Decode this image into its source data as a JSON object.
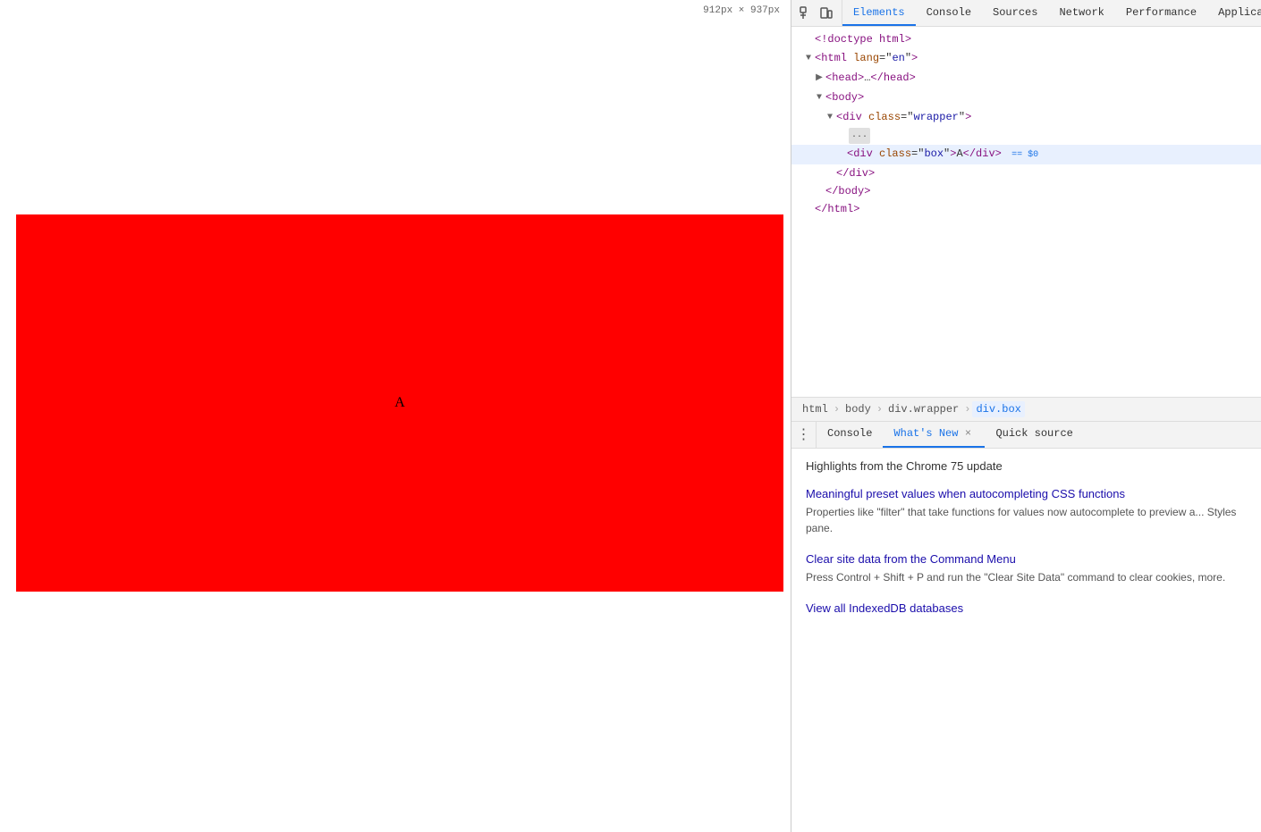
{
  "viewport": {
    "size_label": "912px × 937px",
    "red_box_text": "A"
  },
  "devtools": {
    "tabs": [
      {
        "id": "elements",
        "label": "Elements",
        "active": true
      },
      {
        "id": "console",
        "label": "Console",
        "active": false
      },
      {
        "id": "sources",
        "label": "Sources",
        "active": false
      },
      {
        "id": "network",
        "label": "Network",
        "active": false
      },
      {
        "id": "performance",
        "label": "Performance",
        "active": false
      },
      {
        "id": "application",
        "label": "Applicati...",
        "active": false
      }
    ],
    "html_tree": {
      "lines": [
        {
          "id": "doctype",
          "indent": 0,
          "toggle": "none",
          "content": "<!doctype html>",
          "type": "doctype"
        },
        {
          "id": "html-open",
          "indent": 0,
          "toggle": "expanded",
          "content": "<html lang=\"en\">",
          "type": "tag"
        },
        {
          "id": "head",
          "indent": 1,
          "toggle": "collapsed",
          "content": "<head>…</head>",
          "type": "tag"
        },
        {
          "id": "body-open",
          "indent": 1,
          "toggle": "expanded",
          "content": "<body>",
          "type": "tag"
        },
        {
          "id": "div-wrapper",
          "indent": 2,
          "toggle": "expanded",
          "content": "<div class=\"wrapper\">",
          "type": "tag"
        },
        {
          "id": "ellipsis",
          "indent": 3,
          "toggle": "none",
          "content": "...",
          "type": "ellipsis"
        },
        {
          "id": "div-box",
          "indent": 3,
          "toggle": "none",
          "content": "<div class=\"box\">A</div>",
          "type": "tag",
          "selected": true,
          "marker": "== $0"
        },
        {
          "id": "div-close",
          "indent": 2,
          "toggle": "none",
          "content": "</div>",
          "type": "tag"
        },
        {
          "id": "body-close",
          "indent": 1,
          "toggle": "none",
          "content": "</body>",
          "type": "tag"
        },
        {
          "id": "html-close",
          "indent": 0,
          "toggle": "none",
          "content": "</html>",
          "type": "tag"
        }
      ]
    },
    "breadcrumbs": [
      {
        "id": "html",
        "label": "html"
      },
      {
        "id": "body",
        "label": "body"
      },
      {
        "id": "div-wrapper",
        "label": "div.wrapper"
      },
      {
        "id": "div-box",
        "label": "div.box",
        "active": true
      }
    ],
    "bottom_tabs": [
      {
        "id": "console",
        "label": "Console",
        "closeable": false,
        "active": false
      },
      {
        "id": "whats-new",
        "label": "What's New",
        "closeable": true,
        "active": true
      },
      {
        "id": "quick-source",
        "label": "Quick source",
        "closeable": false,
        "active": false
      }
    ],
    "whats_new": {
      "header": "Highlights from the Chrome 75 update",
      "items": [
        {
          "id": "item1",
          "title": "Meaningful preset values when autocompleting CSS functions",
          "desc": "Properties like \"filter\" that take functions for values now autocomplete to preview a... Styles pane."
        },
        {
          "id": "item2",
          "title": "Clear site data from the Command Menu",
          "desc": "Press Control + Shift + P and run the \"Clear Site Data\" command to clear cookies, more."
        },
        {
          "id": "item3",
          "title": "View all IndexedDB databases",
          "desc": ""
        }
      ]
    }
  }
}
